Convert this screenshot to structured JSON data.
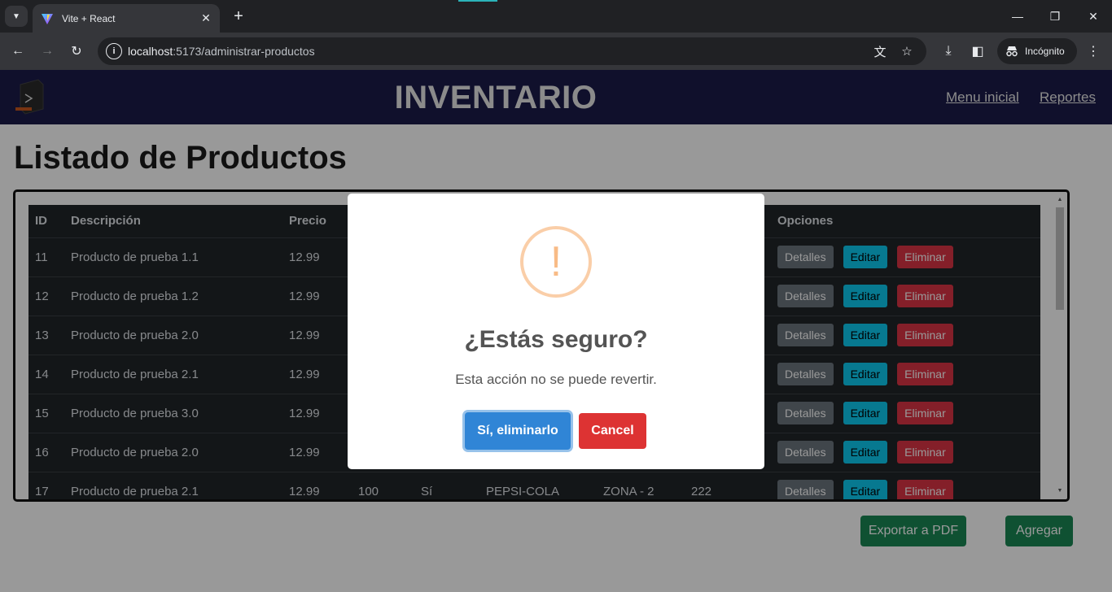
{
  "browser": {
    "tab_title": "Vite + React",
    "url_host": "localhost",
    "url_path": ":5173/administrar-productos",
    "incognito_label": "Incógnito"
  },
  "header": {
    "title": "INVENTARIO",
    "nav": [
      "Menu inicial",
      "Reportes"
    ]
  },
  "page": {
    "heading": "Listado de Productos"
  },
  "table": {
    "columns": {
      "id": "ID",
      "descripcion": "Descripción",
      "precio": "Precio",
      "opciones": "Opciones"
    },
    "rows": [
      {
        "id": "11",
        "descripcion": "Producto de prueba 1.1",
        "precio": "12.99",
        "stock": "",
        "activo": "",
        "marca": "",
        "zona": "",
        "codigo": ""
      },
      {
        "id": "12",
        "descripcion": "Producto de prueba 1.2",
        "precio": "12.99",
        "stock": "",
        "activo": "",
        "marca": "",
        "zona": "",
        "codigo": ""
      },
      {
        "id": "13",
        "descripcion": "Producto de prueba 2.0",
        "precio": "12.99",
        "stock": "",
        "activo": "",
        "marca": "",
        "zona": "",
        "codigo": ""
      },
      {
        "id": "14",
        "descripcion": "Producto de prueba 2.1",
        "precio": "12.99",
        "stock": "",
        "activo": "",
        "marca": "",
        "zona": "",
        "codigo": ""
      },
      {
        "id": "15",
        "descripcion": "Producto de prueba 3.0",
        "precio": "12.99",
        "stock": "",
        "activo": "",
        "marca": "",
        "zona": "",
        "codigo": ""
      },
      {
        "id": "16",
        "descripcion": "Producto de prueba 2.0",
        "precio": "12.99",
        "stock": "",
        "activo": "",
        "marca": "",
        "zona": "",
        "codigo": ""
      },
      {
        "id": "17",
        "descripcion": "Producto de prueba 2.1",
        "precio": "12.99",
        "stock": "100",
        "activo": "Sí",
        "marca": "PEPSI-COLA",
        "zona": "ZONA - 2",
        "codigo": "222"
      }
    ],
    "actions": {
      "details": "Detalles",
      "edit": "Editar",
      "delete": "Eliminar"
    }
  },
  "footer_buttons": {
    "export": "Exportar a PDF",
    "add": "Agregar"
  },
  "modal": {
    "icon": "!",
    "title": "¿Estás seguro?",
    "text": "Esta acción no se puede revertir.",
    "confirm": "Sí, eliminarlo",
    "cancel": "Cancel"
  },
  "colors": {
    "header_bg": "#1c1c4a",
    "confirm": "#3085d6",
    "cancel": "#dd3333",
    "details": "#6c757d",
    "edit": "#0dcaf0",
    "delete": "#dc3545",
    "success": "#198754"
  }
}
